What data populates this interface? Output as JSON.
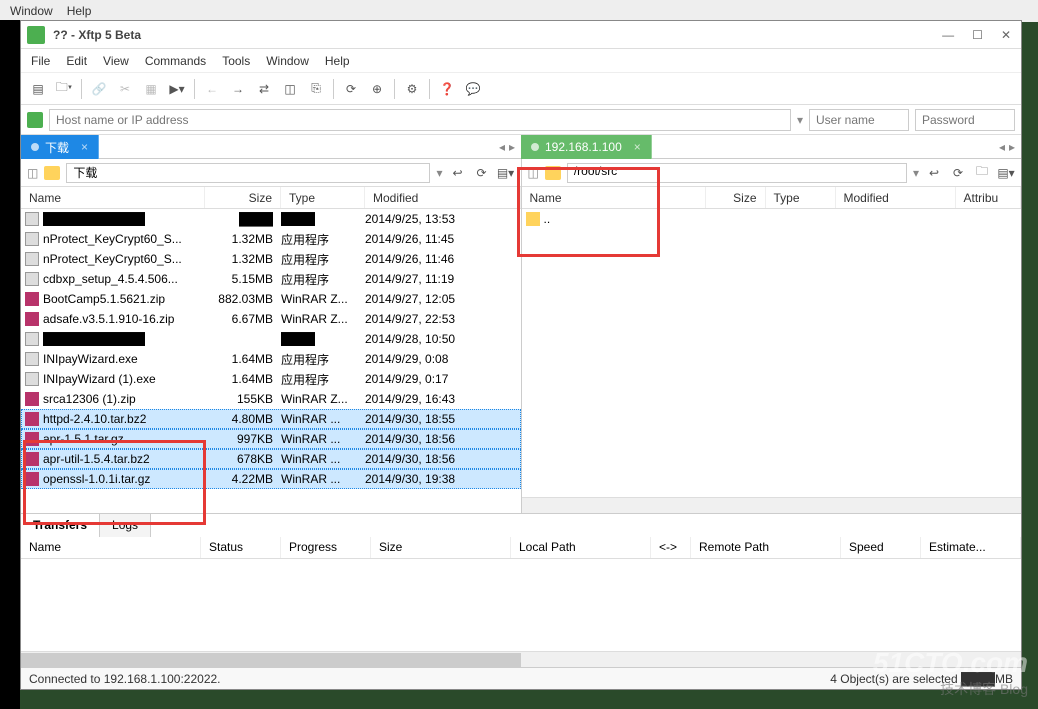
{
  "bg_menu": {
    "window": "Window",
    "help": "Help"
  },
  "window": {
    "title": "??  - Xftp 5 Beta",
    "minimize": "—",
    "maximize": "☐",
    "close": "✕"
  },
  "menu": {
    "file": "File",
    "edit": "Edit",
    "view": "View",
    "commands": "Commands",
    "tools": "Tools",
    "window": "Window",
    "help": "Help"
  },
  "address": {
    "host_placeholder": "Host name or IP address",
    "user_placeholder": "User name",
    "pass_placeholder": "Password"
  },
  "tabs": {
    "local": "下载",
    "remote": "192.168.1.100"
  },
  "left_pane": {
    "path": "下载",
    "columns": {
      "name": "Name",
      "size": "Size",
      "type": "Type",
      "modified": "Modified"
    },
    "files": [
      {
        "name": "████████████",
        "size": "████",
        "type": "████",
        "modified": "2014/9/25, 13:53",
        "icon": "exe",
        "sel": false
      },
      {
        "name": "nProtect_KeyCrypt60_S...",
        "size": "1.32MB",
        "type": "应用程序",
        "modified": "2014/9/26, 11:45",
        "icon": "exe",
        "sel": false
      },
      {
        "name": "nProtect_KeyCrypt60_S...",
        "size": "1.32MB",
        "type": "应用程序",
        "modified": "2014/9/26, 11:46",
        "icon": "exe",
        "sel": false
      },
      {
        "name": "cdbxp_setup_4.5.4.506...",
        "size": "5.15MB",
        "type": "应用程序",
        "modified": "2014/9/27, 11:19",
        "icon": "exe",
        "sel": false
      },
      {
        "name": "BootCamp5.1.5621.zip",
        "size": "882.03MB",
        "type": "WinRAR Z...",
        "modified": "2014/9/27, 12:05",
        "icon": "zip",
        "sel": false
      },
      {
        "name": "adsafe.v3.5.1.910-16.zip",
        "size": "6.67MB",
        "type": "WinRAR Z...",
        "modified": "2014/9/27, 22:53",
        "icon": "zip",
        "sel": false
      },
      {
        "name": "████████████",
        "size": "",
        "type": "████",
        "modified": "2014/9/28, 10:50",
        "icon": "exe",
        "sel": false
      },
      {
        "name": "INIpayWizard.exe",
        "size": "1.64MB",
        "type": "应用程序",
        "modified": "2014/9/29, 0:08",
        "icon": "exe",
        "sel": false
      },
      {
        "name": "INIpayWizard (1).exe",
        "size": "1.64MB",
        "type": "应用程序",
        "modified": "2014/9/29, 0:17",
        "icon": "exe",
        "sel": false
      },
      {
        "name": "srca12306 (1).zip",
        "size": "155KB",
        "type": "WinRAR Z...",
        "modified": "2014/9/29, 16:43",
        "icon": "zip",
        "sel": false
      },
      {
        "name": "httpd-2.4.10.tar.bz2",
        "size": "4.80MB",
        "type": "WinRAR ...",
        "modified": "2014/9/30, 18:55",
        "icon": "zip",
        "sel": true
      },
      {
        "name": "apr-1.5.1.tar.gz",
        "size": "997KB",
        "type": "WinRAR ...",
        "modified": "2014/9/30, 18:56",
        "icon": "zip",
        "sel": true
      },
      {
        "name": "apr-util-1.5.4.tar.bz2",
        "size": "678KB",
        "type": "WinRAR ...",
        "modified": "2014/9/30, 18:56",
        "icon": "zip",
        "sel": true
      },
      {
        "name": "openssl-1.0.1i.tar.gz",
        "size": "4.22MB",
        "type": "WinRAR ...",
        "modified": "2014/9/30, 19:38",
        "icon": "zip",
        "sel": true
      }
    ]
  },
  "right_pane": {
    "path": "/root/src",
    "columns": {
      "name": "Name",
      "size": "Size",
      "type": "Type",
      "modified": "Modified",
      "attr": "Attribu"
    },
    "files": [
      {
        "name": "..",
        "size": "",
        "type": "",
        "modified": "",
        "icon": "folder",
        "sel": false
      }
    ]
  },
  "bottom": {
    "tab_transfers": "Transfers",
    "tab_logs": "Logs",
    "columns": {
      "name": "Name",
      "status": "Status",
      "progress": "Progress",
      "size": "Size",
      "local": "Local Path",
      "arrows": "<->",
      "remote": "Remote Path",
      "speed": "Speed",
      "estimate": "Estimate..."
    }
  },
  "status": {
    "left": "Connected to 192.168.1.100:22022.",
    "right": "4 Object(s) are selected ████MB"
  },
  "watermark1": "51CTO.com",
  "watermark2": "技术博客 Blog"
}
